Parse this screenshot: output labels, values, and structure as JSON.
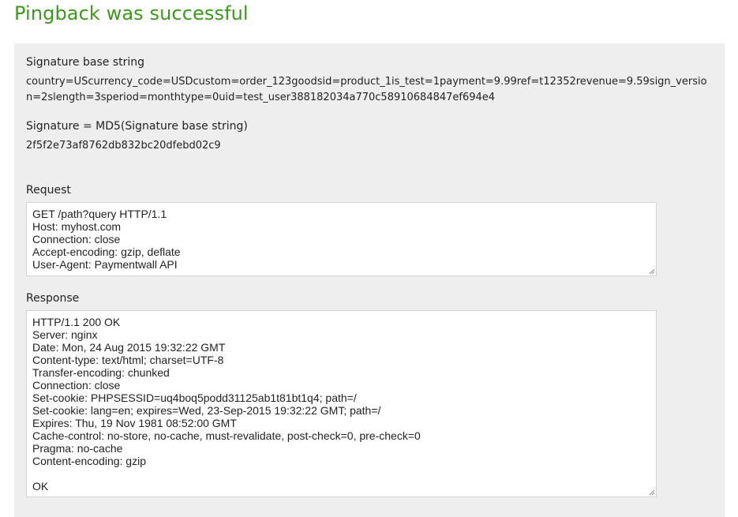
{
  "title": "Pingback was successful",
  "signature_base": {
    "label": "Signature base string",
    "value": "country=UScurrency_code=USDcustom=order_123goodsid=product_1is_test=1payment=9.99ref=t12352revenue=9.59sign_version=2slength=3speriod=monthtype=0uid=test_user388182034a770c58910684847ef694e4"
  },
  "signature": {
    "label": "Signature = MD5(Signature base string)",
    "value": "2f5f2e73af8762db832bc20dfebd02c9"
  },
  "request": {
    "label": "Request",
    "content": "GET /path?query HTTP/1.1\nHost: myhost.com\nConnection: close\nAccept-encoding: gzip, deflate\nUser-Agent: Paymentwall API"
  },
  "response": {
    "label": "Response",
    "content": "HTTP/1.1 200 OK\nServer: nginx\nDate: Mon, 24 Aug 2015 19:32:22 GMT\nContent-type: text/html; charset=UTF-8\nTransfer-encoding: chunked\nConnection: close\nSet-cookie: PHPSESSID=uq4boq5podd31125ab1t81bt1q4; path=/\nSet-cookie: lang=en; expires=Wed, 23-Sep-2015 19:32:22 GMT; path=/\nExpires: Thu, 19 Nov 1981 08:52:00 GMT\nCache-control: no-store, no-cache, must-revalidate, post-check=0, pre-check=0\nPragma: no-cache\nContent-encoding: gzip\n\nOK"
  },
  "colors": {
    "title": "#3a9a19",
    "panel_background": "#eeeeee"
  }
}
